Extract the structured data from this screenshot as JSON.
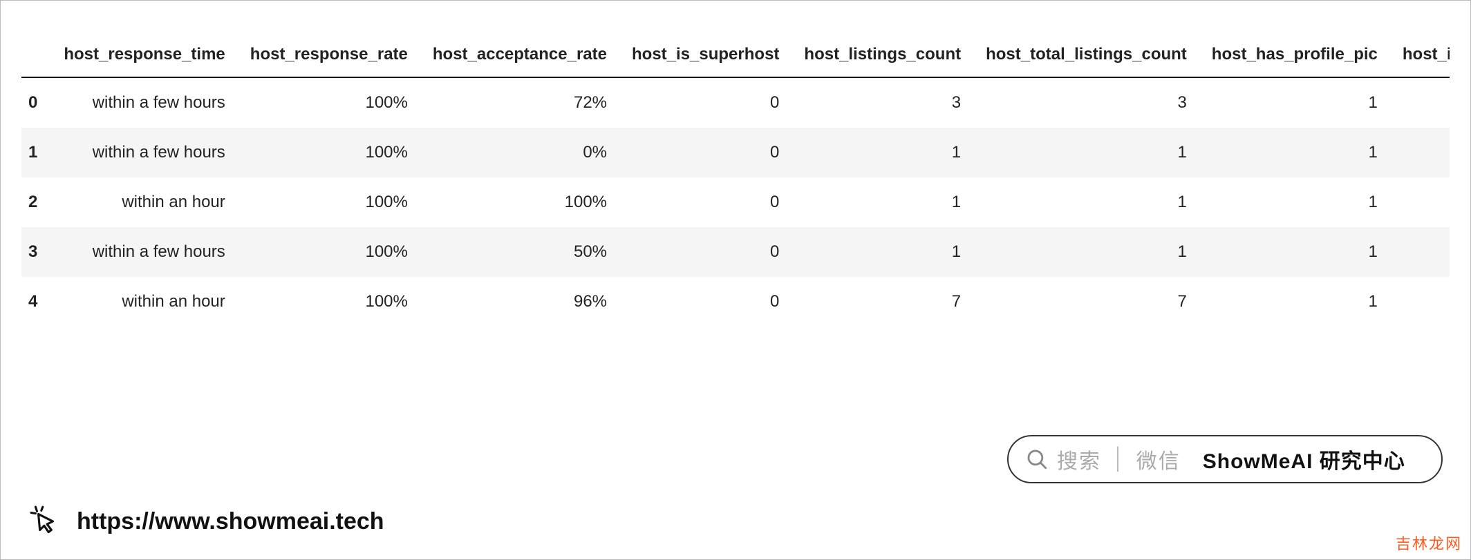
{
  "chart_data": {
    "type": "table",
    "columns": [
      "host_response_time",
      "host_response_rate",
      "host_acceptance_rate",
      "host_is_superhost",
      "host_listings_count",
      "host_total_listings_count",
      "host_has_profile_pic",
      "host_identity_verif"
    ],
    "index": [
      "0",
      "1",
      "2",
      "3",
      "4"
    ],
    "rows": [
      [
        "within a few hours",
        "100%",
        "72%",
        "0",
        "3",
        "3",
        "1",
        ""
      ],
      [
        "within a few hours",
        "100%",
        "0%",
        "0",
        "1",
        "1",
        "1",
        ""
      ],
      [
        "within an hour",
        "100%",
        "100%",
        "0",
        "1",
        "1",
        "1",
        ""
      ],
      [
        "within a few hours",
        "100%",
        "50%",
        "0",
        "1",
        "1",
        "1",
        ""
      ],
      [
        "within an hour",
        "100%",
        "96%",
        "0",
        "7",
        "7",
        "1",
        ""
      ]
    ]
  },
  "search": {
    "hint1": "搜索",
    "hint2": "微信",
    "brand": "ShowMeAI 研究中心"
  },
  "footer": {
    "url": "https://www.showmeai.tech",
    "watermark": "吉林龙网"
  }
}
